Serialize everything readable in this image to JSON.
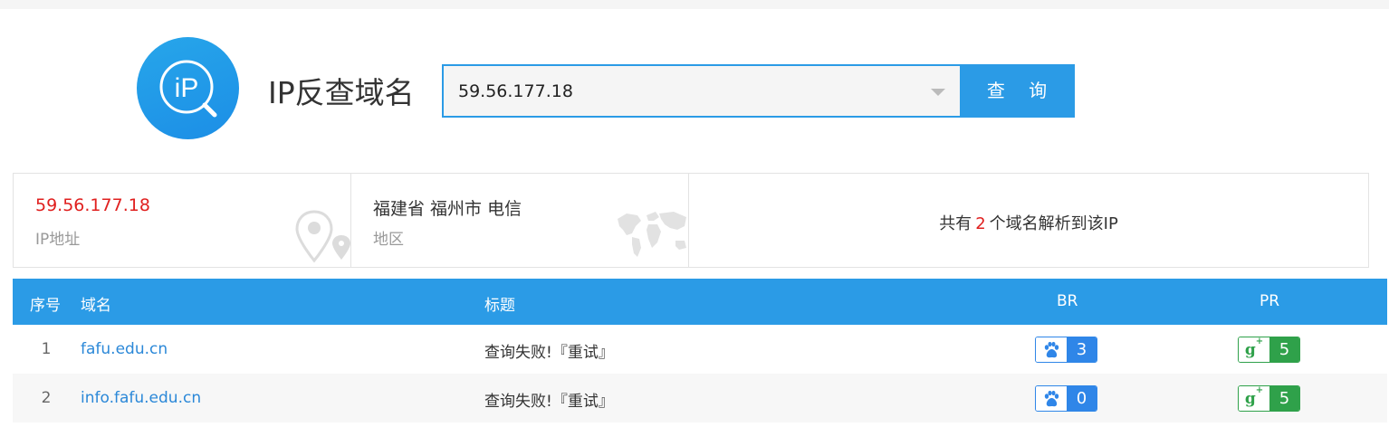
{
  "header": {
    "app_title": "IP反查域名",
    "logo_text": "iP",
    "search_value": "59.56.177.18",
    "query_button": "查 询"
  },
  "info": {
    "ip_value": "59.56.177.18",
    "ip_label": "IP地址",
    "region_value": "福建省 福州市 电信",
    "region_label": "地区",
    "count_prefix": "共有",
    "count_value": "2",
    "count_suffix": "个域名解析到该IP"
  },
  "table": {
    "headers": {
      "index": "序号",
      "domain": "域名",
      "title": "标题",
      "br": "BR",
      "pr": "PR"
    },
    "rows": [
      {
        "index": "1",
        "domain": "fafu.edu.cn",
        "title": "查询失败!『重试』",
        "br": "3",
        "pr": "5"
      },
      {
        "index": "2",
        "domain": "info.fafu.edu.cn",
        "title": "查询失败!『重试』",
        "br": "0",
        "pr": "5"
      }
    ]
  },
  "icons": {
    "logo": "ip-search-icon",
    "location": "location-pin-icon",
    "world": "world-map-icon",
    "baidu": "baidu-paw-icon",
    "google_plus": "google-plus-icon"
  },
  "colors": {
    "accent": "#2b9be6",
    "highlight_red": "#e0201f",
    "baidu_blue": "#2f86e8",
    "google_green": "#2fa14a"
  }
}
